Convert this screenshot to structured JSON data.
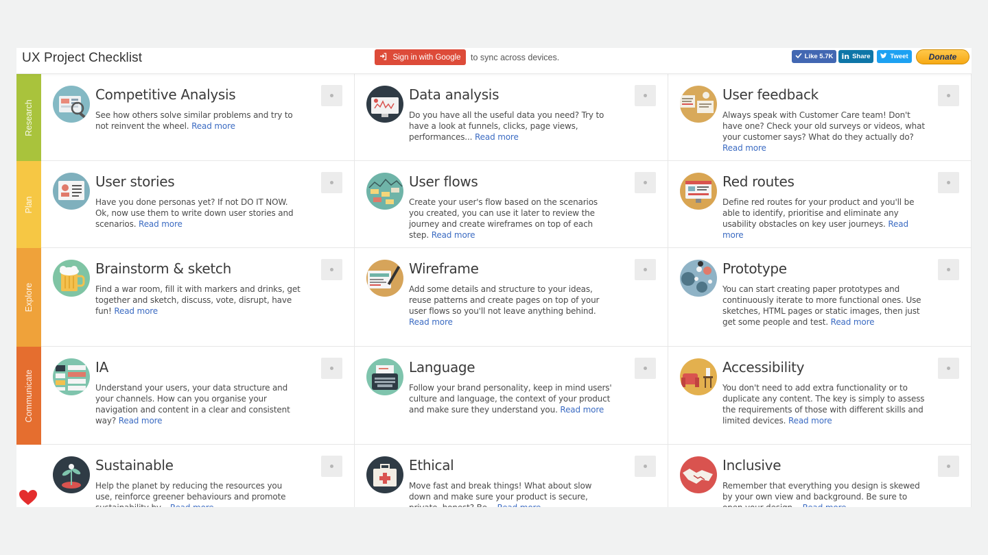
{
  "header": {
    "title": "UX Project Checklist",
    "google_label": "Sign in with Google",
    "sync_text": "to sync across devices.",
    "fb_label": "Like 5.7K",
    "li_label": "Share",
    "tw_label": "Tweet",
    "donate_label": "Donate"
  },
  "phases": [
    "Research",
    "Plan",
    "Explore",
    "Communicate"
  ],
  "colors": {
    "research": "#a9c33c",
    "plan": "#f6c744",
    "explore": "#efa23a",
    "communicate": "#e56e2f",
    "heart": "#e42d2d",
    "link": "#3b6bc2",
    "google": "#dd4b39"
  },
  "read_more": "Read more",
  "cards": [
    {
      "title": "Competitive Analysis",
      "text": "See how others solve similar problems and try to not reinvent the wheel.",
      "icon": "competitive-analysis-icon"
    },
    {
      "title": "Data analysis",
      "text": "Do you have all the useful data you need? Try to have a look at funnels, clicks, page views, performances...",
      "icon": "data-analysis-icon"
    },
    {
      "title": "User feedback",
      "text": "Always speak with Customer Care team! Don't have one? Check your old surveys or videos, what your customer says? What do they actually do?",
      "icon": "user-feedback-icon"
    },
    {
      "title": "User stories",
      "text": "Have you done personas yet? If not DO IT NOW. Ok, now use them to write down user stories and scenarios.",
      "icon": "user-stories-icon"
    },
    {
      "title": "User flows",
      "text": "Create your user's flow based on the scenarios you created, you can use it later to review the journey and create wireframes on top of each step.",
      "icon": "user-flows-icon"
    },
    {
      "title": "Red routes",
      "text": "Define red routes for your product and you'll be able to identify, prioritise and eliminate any usability obstacles on key user journeys.",
      "icon": "red-routes-icon"
    },
    {
      "title": "Brainstorm & sketch",
      "text": "Find a war room, fill it with markers and drinks, get together and sketch, discuss, vote, disrupt, have fun!",
      "icon": "beer-mug-icon"
    },
    {
      "title": "Wireframe",
      "text": "Add some details and structure to your ideas, reuse patterns and create pages on top of your user flows so you'll not leave anything behind.",
      "icon": "wireframe-icon"
    },
    {
      "title": "Prototype",
      "text": "You can start creating paper prototypes and continuously iterate to more functional ones. Use sketches, HTML pages or static images, then just get some people and test.",
      "icon": "prototype-icon"
    },
    {
      "title": "IA",
      "text": "Understand your users, your data structure and your channels. How can you organise your navigation and content in a clear and consistent way?",
      "icon": "ia-icon"
    },
    {
      "title": "Language",
      "text": "Follow your brand personality, keep in mind users' culture and language, the context of your product and make sure they understand you.",
      "icon": "typewriter-icon"
    },
    {
      "title": "Accessibility",
      "text": "You don't need to add extra functionality or to duplicate any content. The key is simply to assess the requirements of those with different skills and limited devices.",
      "icon": "accessibility-icon"
    },
    {
      "title": "Sustainable",
      "text": "Help the planet by reducing the resources you use, reinforce greener behaviours and promote sustainability by...",
      "icon": "plant-icon"
    },
    {
      "title": "Ethical",
      "text": "Move fast and break things! What about slow down and make sure your product is secure, private, honest? Be...",
      "icon": "first-aid-kit-icon"
    },
    {
      "title": "Inclusive",
      "text": "Remember that everything you design is skewed by your own view and background. Be sure to open your design...",
      "icon": "handshake-icon"
    }
  ]
}
